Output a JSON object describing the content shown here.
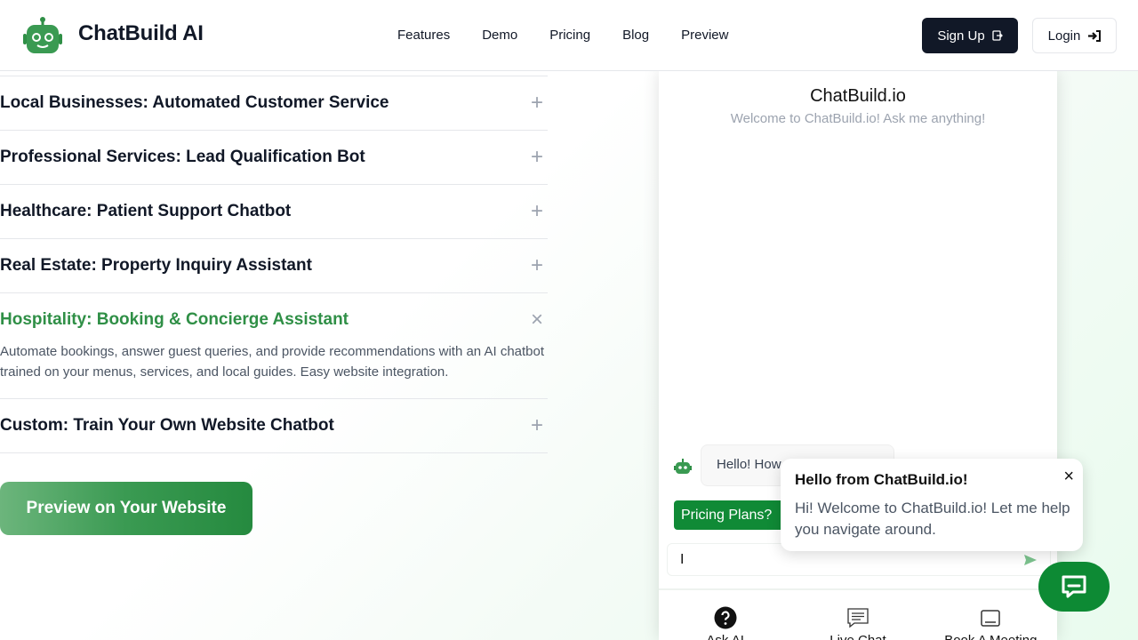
{
  "header": {
    "brand": "ChatBuild AI",
    "nav": [
      "Features",
      "Demo",
      "Pricing",
      "Blog",
      "Preview"
    ],
    "signup_label": "Sign Up",
    "login_label": "Login"
  },
  "accordion": {
    "items": [
      {
        "title": "Local Businesses: Automated Customer Service",
        "open": false
      },
      {
        "title": "Professional Services: Lead Qualification Bot",
        "open": false
      },
      {
        "title": "Healthcare: Patient Support Chatbot",
        "open": false
      },
      {
        "title": "Real Estate: Property Inquiry Assistant",
        "open": false
      },
      {
        "title": "Hospitality: Booking & Concierge Assistant",
        "open": true,
        "body": "Automate bookings, answer guest queries, and provide recommendations with an AI chatbot trained on your menus, services, and local guides. Easy website integration."
      },
      {
        "title": "Custom: Train Your Own Website Chatbot",
        "open": false
      }
    ],
    "plus_symbol": "+",
    "close_symbol": "×"
  },
  "preview_button": "Preview on Your Website",
  "chat": {
    "title": "ChatBuild.io",
    "subtitle": "Welcome to ChatBuild.io! Ask me anything!",
    "bot_message": "Hello! How can I help you today?",
    "chip": "Pricing Plans?",
    "input_value": "I",
    "footer": [
      {
        "label": "Ask AI",
        "icon": "question-icon"
      },
      {
        "label": "Live Chat",
        "icon": "chat-lines-icon"
      },
      {
        "label": "Book A Meeting",
        "icon": "calendar-icon"
      }
    ]
  },
  "toast": {
    "title": "Hello from ChatBuild.io!",
    "message": "Hi! Welcome to ChatBuild.io! Let me help you navigate around.",
    "close_symbol": "×"
  },
  "colors": {
    "brand_green": "#2f8f46",
    "dark": "#111827",
    "launcher_green": "#0d8a34"
  }
}
